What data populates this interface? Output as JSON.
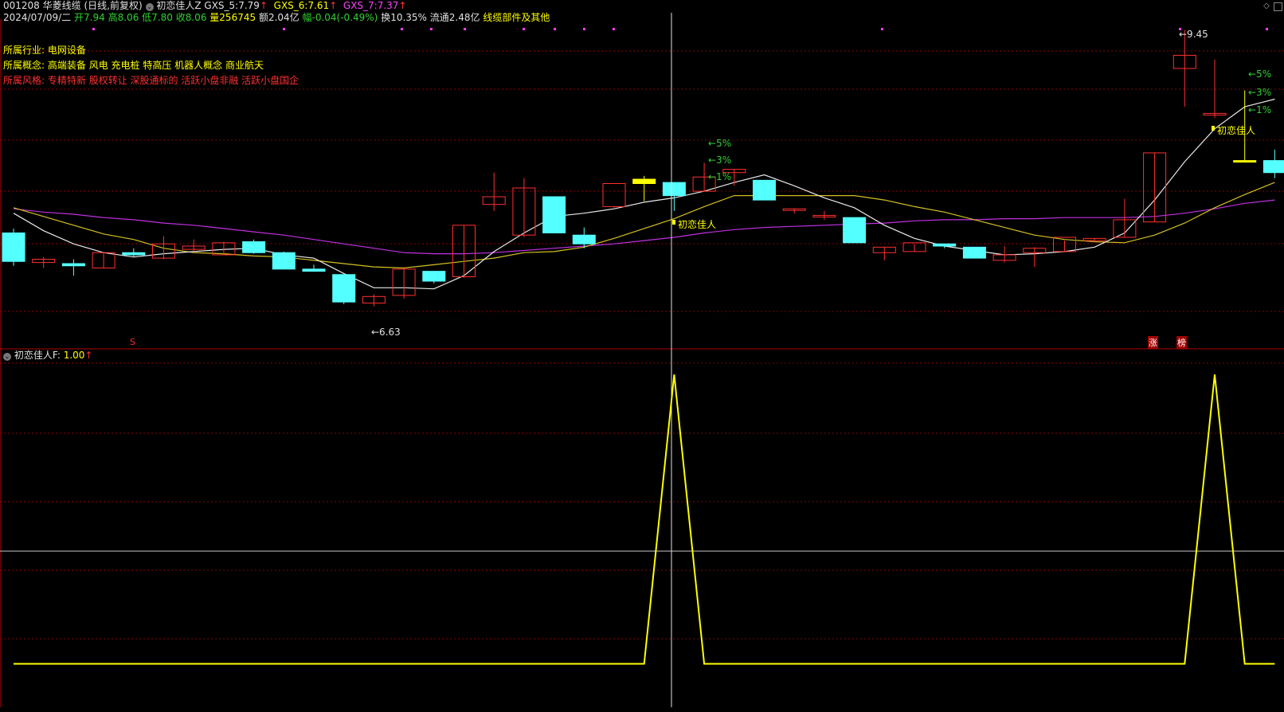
{
  "header": {
    "code": "001208",
    "name": "华菱线缆",
    "period": "(日线,前复权)",
    "indicator_name": "初恋佳人Z",
    "gxs5_label": "GXS_5:",
    "gxs5_value": "7.79",
    "gxs6_label": "GXS_6:",
    "gxs6_value": "7.61",
    "gxs7_label": "GXS_7:",
    "gxs7_value": "7.37",
    "arrow": "↑"
  },
  "quote": {
    "date": "2024/07/09/二",
    "open": "开7.94",
    "high": "高8.06",
    "low": "低7.80",
    "close": "收8.06",
    "volume": "量256745",
    "amount": "额2.04亿",
    "change": "幅-0.04(-0.49%)",
    "turnover": "换10.35%",
    "float": "流通2.48亿",
    "sector": "线缆部件及其他"
  },
  "info": {
    "industry_label": "所属行业:",
    "industry": "电网设备",
    "concept_label": "所属概念:",
    "concepts": "高端装备 风电 充电桩 特高压 机器人概念 商业航天",
    "style_label": "所属风格:",
    "styles": "专精特新 股权转让 深股通标的 活跃小盘非融 活跃小盘国企"
  },
  "annotations": {
    "low_price": "←6.63",
    "high_price": "←9.45",
    "signal_label": "初恋佳人",
    "pct5": "←5%",
    "pct3": "←3%",
    "pct1": "←1%",
    "mark_s": "S",
    "mark_zhang": "涨",
    "mark_bang": "榜"
  },
  "lower_panel": {
    "indicator": "初恋佳人F",
    "value": "1.00"
  },
  "colors": {
    "up": "#ff3030",
    "down": "#54ffff",
    "ma5": "#e8e8e8",
    "ma6": "#d4c020",
    "ma7": "#c030e0",
    "signal": "#ffff00",
    "grid": "#8b0000"
  },
  "chart_data": {
    "type": "candlestick",
    "candles": [
      {
        "o": 7.6,
        "h": 7.64,
        "l": 7.3,
        "c": 7.34
      },
      {
        "o": 7.33,
        "h": 7.38,
        "l": 7.28,
        "c": 7.36
      },
      {
        "o": 7.32,
        "h": 7.36,
        "l": 7.21,
        "c": 7.3
      },
      {
        "o": 7.28,
        "h": 7.42,
        "l": 7.28,
        "c": 7.42
      },
      {
        "o": 7.42,
        "h": 7.46,
        "l": 7.38,
        "c": 7.4
      },
      {
        "o": 7.37,
        "h": 7.57,
        "l": 7.36,
        "c": 7.5
      },
      {
        "o": 7.45,
        "h": 7.54,
        "l": 7.43,
        "c": 7.48
      },
      {
        "o": 7.4,
        "h": 7.52,
        "l": 7.4,
        "c": 7.51
      },
      {
        "o": 7.52,
        "h": 7.54,
        "l": 7.41,
        "c": 7.42
      },
      {
        "o": 7.42,
        "h": 7.43,
        "l": 7.27,
        "c": 7.27
      },
      {
        "o": 7.27,
        "h": 7.31,
        "l": 7.25,
        "c": 7.25
      },
      {
        "o": 7.22,
        "h": 7.22,
        "l": 6.95,
        "c": 6.97
      },
      {
        "o": 6.96,
        "h": 7.04,
        "l": 6.93,
        "c": 7.02
      },
      {
        "o": 7.03,
        "h": 7.28,
        "l": 7.0,
        "c": 7.27
      },
      {
        "o": 7.25,
        "h": 7.25,
        "l": 7.14,
        "c": 7.16
      },
      {
        "o": 7.2,
        "h": 7.67,
        "l": 7.19,
        "c": 7.67
      },
      {
        "o": 7.86,
        "h": 8.15,
        "l": 7.8,
        "c": 7.93
      },
      {
        "o": 7.58,
        "h": 8.1,
        "l": 7.56,
        "c": 8.01
      },
      {
        "o": 7.93,
        "h": 7.93,
        "l": 7.6,
        "c": 7.6
      },
      {
        "o": 7.58,
        "h": 7.65,
        "l": 7.46,
        "c": 7.5
      },
      {
        "o": 7.84,
        "h": 7.84,
        "l": 7.83,
        "c": 8.05
      },
      {
        "o": 8.05,
        "h": 8.12,
        "l": 7.89,
        "c": 8.09
      },
      {
        "o": 8.06,
        "h": 8.06,
        "l": 7.8,
        "c": 7.94
      },
      {
        "o": 7.98,
        "h": 8.24,
        "l": 7.98,
        "c": 8.11
      },
      {
        "o": 8.15,
        "h": 8.18,
        "l": 8.03,
        "c": 8.18
      },
      {
        "o": 8.08,
        "h": 8.08,
        "l": 7.9,
        "c": 7.9
      },
      {
        "o": 7.82,
        "h": 7.82,
        "l": 7.78,
        "c": 7.82
      },
      {
        "o": 7.76,
        "h": 7.8,
        "l": 7.72,
        "c": 7.76
      },
      {
        "o": 7.74,
        "h": 7.74,
        "l": 7.51,
        "c": 7.51
      },
      {
        "o": 7.42,
        "h": 7.47,
        "l": 7.35,
        "c": 7.47
      },
      {
        "o": 7.43,
        "h": 7.5,
        "l": 7.43,
        "c": 7.51
      },
      {
        "o": 7.5,
        "h": 7.5,
        "l": 7.46,
        "c": 7.48
      },
      {
        "o": 7.47,
        "h": 7.47,
        "l": 7.37,
        "c": 7.37
      },
      {
        "o": 7.35,
        "h": 7.48,
        "l": 7.33,
        "c": 7.4
      },
      {
        "o": 7.42,
        "h": 7.47,
        "l": 7.29,
        "c": 7.46
      },
      {
        "o": 7.43,
        "h": 7.53,
        "l": 7.43,
        "c": 7.56
      },
      {
        "o": 7.53,
        "h": 7.55,
        "l": 7.52,
        "c": 7.55
      },
      {
        "o": 7.56,
        "h": 7.91,
        "l": 7.56,
        "c": 7.72
      },
      {
        "o": 7.7,
        "h": 8.33,
        "l": 7.7,
        "c": 8.33
      },
      {
        "o": 9.1,
        "h": 9.45,
        "l": 8.75,
        "c": 9.22
      },
      {
        "o": 8.69,
        "h": 9.18,
        "l": 8.65,
        "c": 8.69
      },
      {
        "o": 8.26,
        "h": 8.9,
        "l": 8.26,
        "c": 8.26
      },
      {
        "o": 8.26,
        "h": 8.36,
        "l": 8.1,
        "c": 8.15
      }
    ],
    "ma5": [
      7.78,
      7.62,
      7.5,
      7.42,
      7.38,
      7.41,
      7.43,
      7.45,
      7.46,
      7.4,
      7.37,
      7.23,
      7.1,
      7.1,
      7.09,
      7.21,
      7.43,
      7.6,
      7.75,
      7.78,
      7.82,
      7.88,
      7.92,
      7.98,
      8.06,
      8.13,
      8.03,
      7.92,
      7.83,
      7.67,
      7.55,
      7.48,
      7.44,
      7.4,
      7.41,
      7.43,
      7.47,
      7.6,
      7.9,
      8.25,
      8.55,
      8.75,
      8.82
    ],
    "ma6": [
      7.83,
      7.75,
      7.67,
      7.59,
      7.54,
      7.46,
      7.42,
      7.41,
      7.39,
      7.38,
      7.35,
      7.32,
      7.29,
      7.28,
      7.31,
      7.34,
      7.37,
      7.42,
      7.43,
      7.47,
      7.55,
      7.64,
      7.73,
      7.84,
      7.94,
      7.94,
      7.94,
      7.94,
      7.94,
      7.9,
      7.84,
      7.79,
      7.72,
      7.65,
      7.58,
      7.54,
      7.52,
      7.51,
      7.58,
      7.69,
      7.83,
      7.95,
      8.06
    ],
    "ma7": [
      7.82,
      7.79,
      7.77,
      7.74,
      7.72,
      7.69,
      7.67,
      7.64,
      7.61,
      7.58,
      7.54,
      7.5,
      7.46,
      7.42,
      7.41,
      7.41,
      7.42,
      7.44,
      7.46,
      7.48,
      7.5,
      7.53,
      7.56,
      7.6,
      7.63,
      7.65,
      7.66,
      7.67,
      7.68,
      7.69,
      7.71,
      7.72,
      7.72,
      7.73,
      7.73,
      7.74,
      7.74,
      7.74,
      7.75,
      7.78,
      7.82,
      7.87,
      7.9
    ],
    "signal_F": [
      0,
      0,
      0,
      0,
      0,
      0,
      0,
      0,
      0,
      0,
      0,
      0,
      0,
      0,
      0,
      0,
      0,
      0,
      0,
      0,
      0,
      0,
      1,
      0,
      0,
      0,
      0,
      0,
      0,
      0,
      0,
      0,
      0,
      0,
      0,
      0,
      0,
      0,
      0,
      0,
      1,
      0,
      0
    ],
    "price_range": [
      6.55,
      9.55
    ],
    "f_range": [
      -0.15,
      1.05
    ]
  }
}
